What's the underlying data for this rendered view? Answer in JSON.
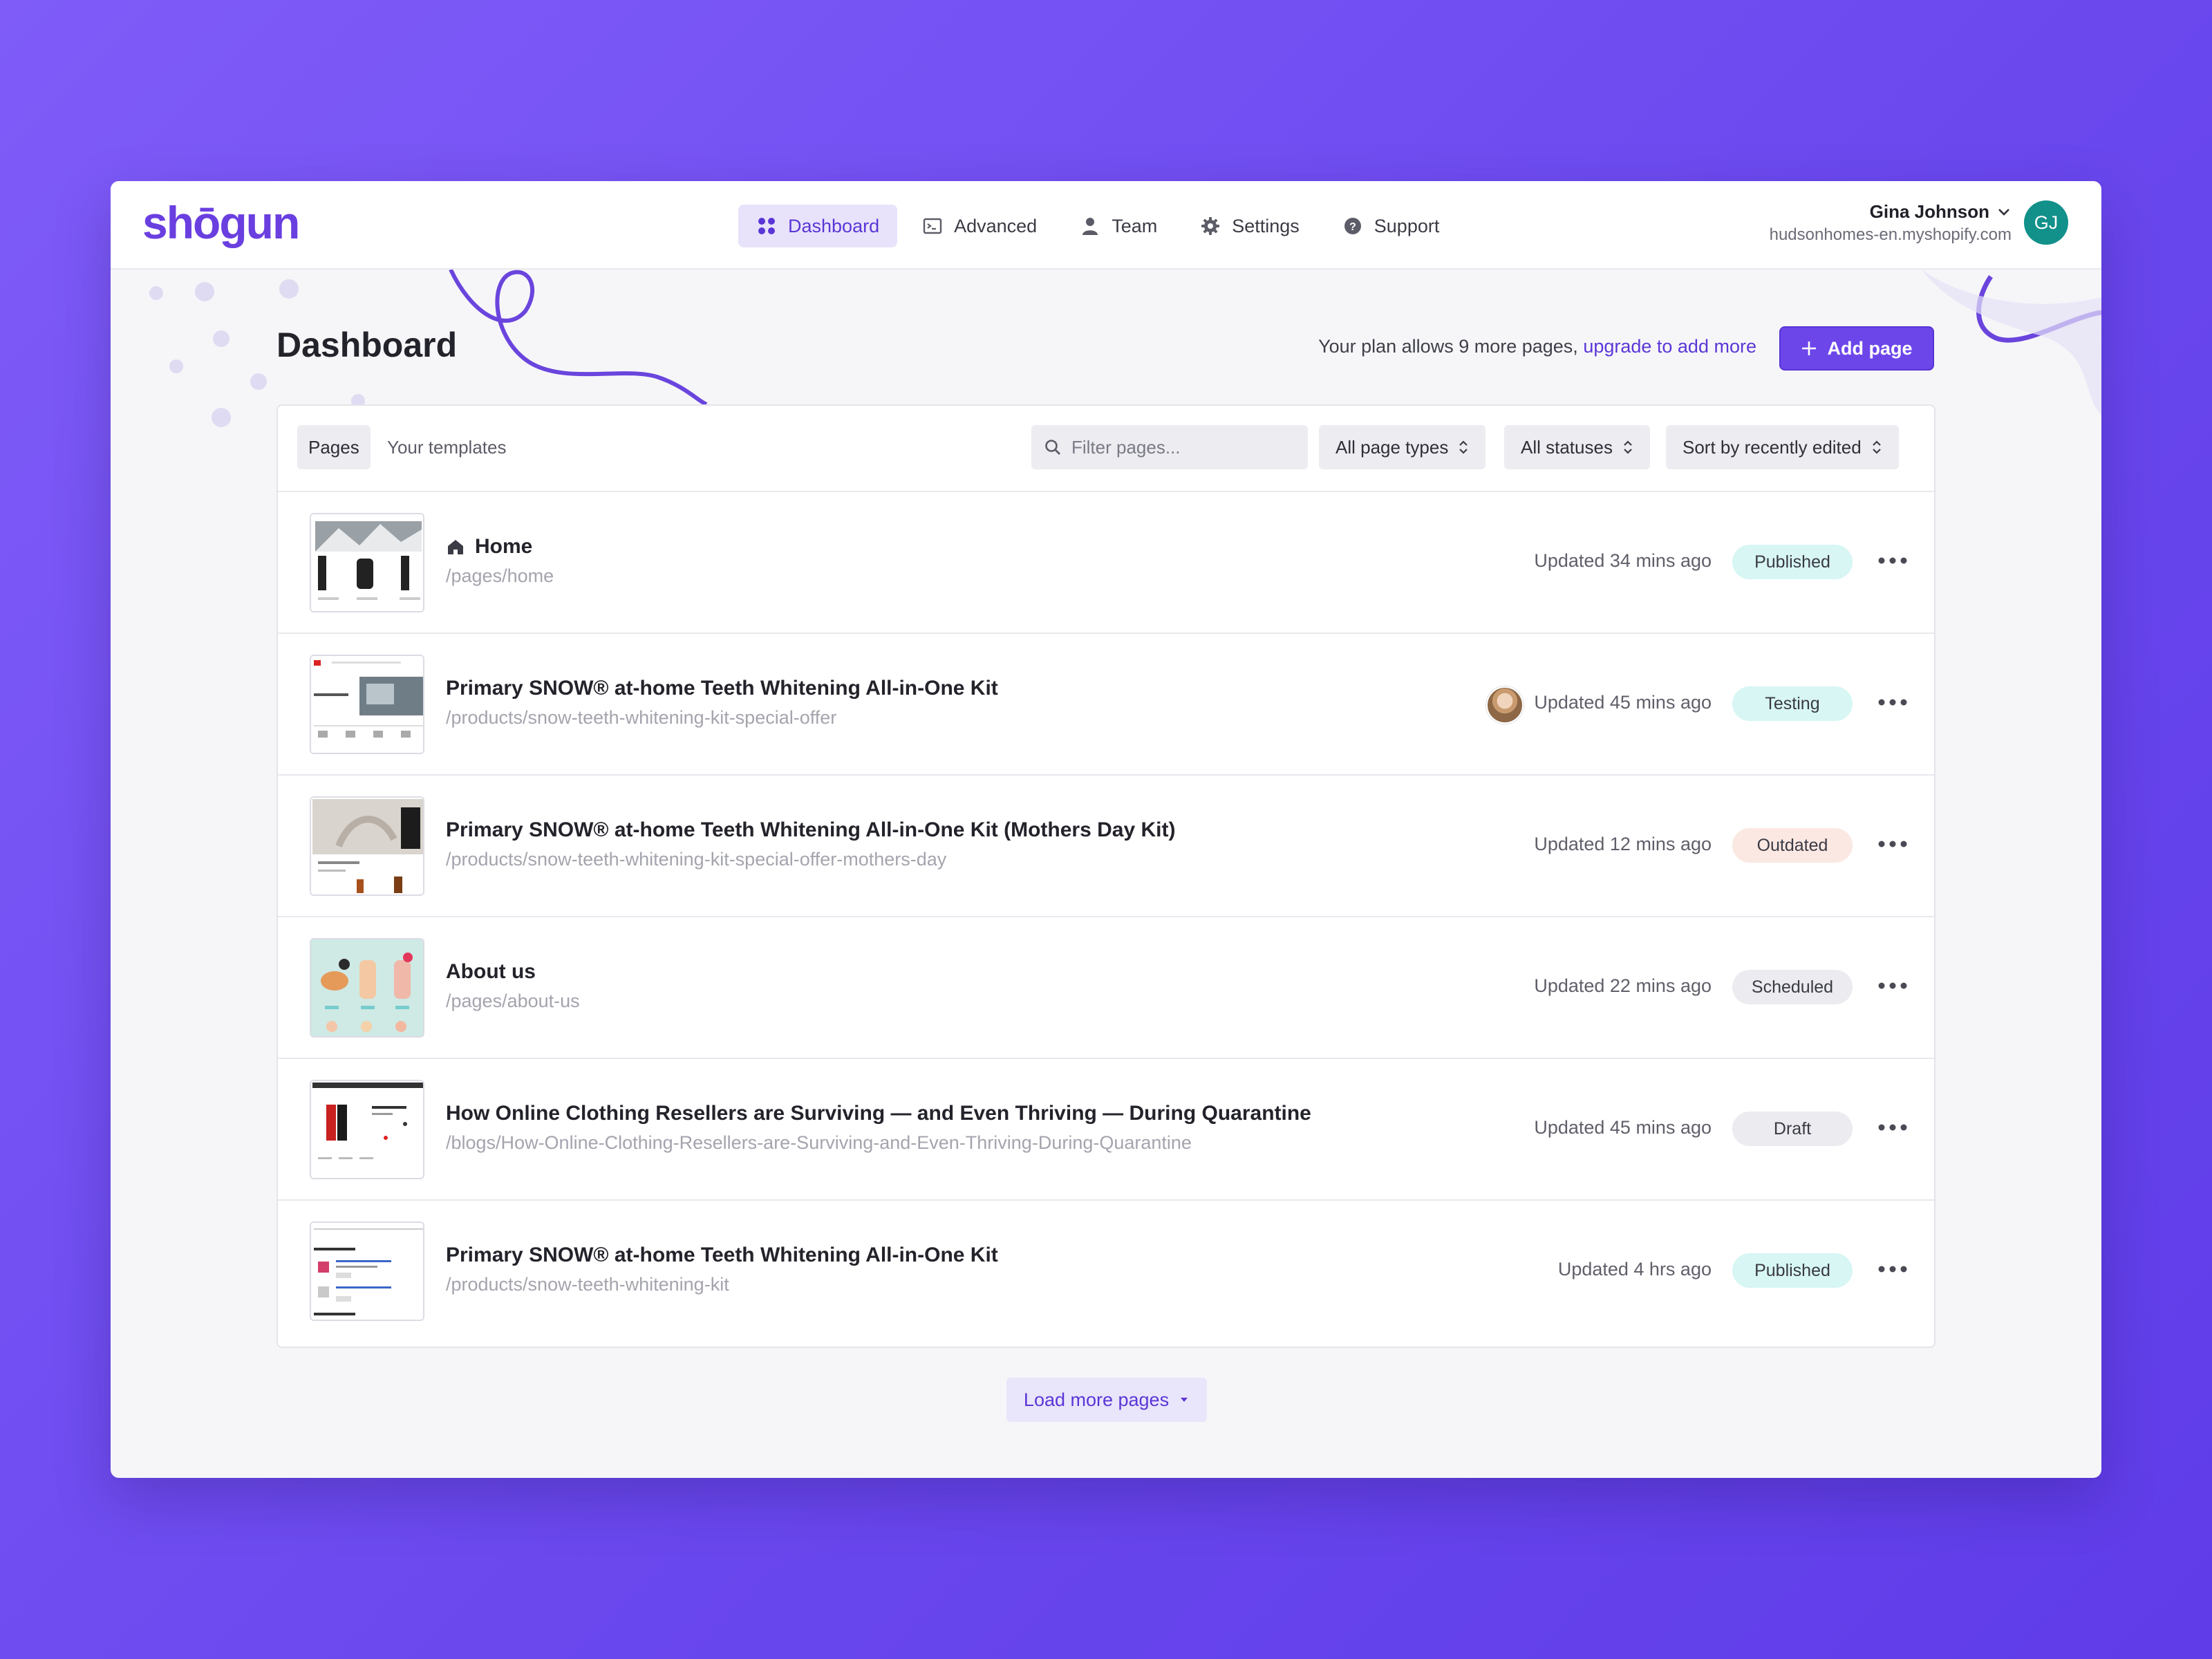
{
  "brand": {
    "logo": "shōgun",
    "accent": "#6d46ea"
  },
  "nav": {
    "items": [
      {
        "label": "Dashboard",
        "icon": "grid-icon",
        "active": true
      },
      {
        "label": "Advanced",
        "icon": "terminal-icon",
        "active": false
      },
      {
        "label": "Team",
        "icon": "person-icon",
        "active": false
      },
      {
        "label": "Settings",
        "icon": "gear-icon",
        "active": false
      },
      {
        "label": "Support",
        "icon": "help-icon",
        "active": false
      }
    ]
  },
  "user": {
    "name": "Gina Johnson",
    "store": "hudsonhomes-en.myshopify.com",
    "initials": "GJ"
  },
  "header": {
    "title": "Dashboard",
    "plan_text": "Your plan allows 9 more pages,",
    "upgrade_link": "upgrade to add more",
    "add_button": "Add page"
  },
  "toolbar": {
    "tabs": [
      "Pages",
      "Your templates"
    ],
    "active_tab": "Pages",
    "filter_placeholder": "Filter pages...",
    "page_type": "All page types",
    "status": "All statuses",
    "sort": "Sort by recently edited"
  },
  "pages": [
    {
      "title": "Home",
      "path": "/pages/home",
      "updated": "Updated 34 mins ago",
      "status": "Published",
      "status_color": "#d7f6f4",
      "home_icon": true,
      "has_avatar": false
    },
    {
      "title": "Primary SNOW® at-home Teeth Whitening All-in-One Kit",
      "path": "/products/snow-teeth-whitening-kit-special-offer",
      "updated": "Updated 45 mins ago",
      "status": "Testing",
      "status_color": "#d7f6f4",
      "home_icon": false,
      "has_avatar": true
    },
    {
      "title": "Primary SNOW® at-home Teeth Whitening All-in-One Kit (Mothers Day Kit)",
      "path": "/products/snow-teeth-whitening-kit-special-offer-mothers-day",
      "updated": "Updated 12 mins ago",
      "status": "Outdated",
      "status_color": "#fbe8e3",
      "home_icon": false,
      "has_avatar": false
    },
    {
      "title": "About us",
      "path": "/pages/about-us",
      "updated": "Updated 22 mins ago",
      "status": "Scheduled",
      "status_color": "#ebebf0",
      "home_icon": false,
      "has_avatar": false
    },
    {
      "title": "How Online Clothing Resellers are Surviving — and Even Thriving — During Quarantine",
      "path": "/blogs/How-Online-Clothing-Resellers-are-Surviving-and-Even-Thriving-During-Quarantine",
      "updated": "Updated 45 mins ago",
      "status": "Draft",
      "status_color": "#ebebf0",
      "home_icon": false,
      "has_avatar": false
    },
    {
      "title": "Primary SNOW® at-home Teeth Whitening All-in-One Kit",
      "path": "/products/snow-teeth-whitening-kit",
      "updated": "Updated 4 hrs ago",
      "status": "Published",
      "status_color": "#d7f6f4",
      "home_icon": false,
      "has_avatar": false
    }
  ],
  "load_more": "Load more pages"
}
